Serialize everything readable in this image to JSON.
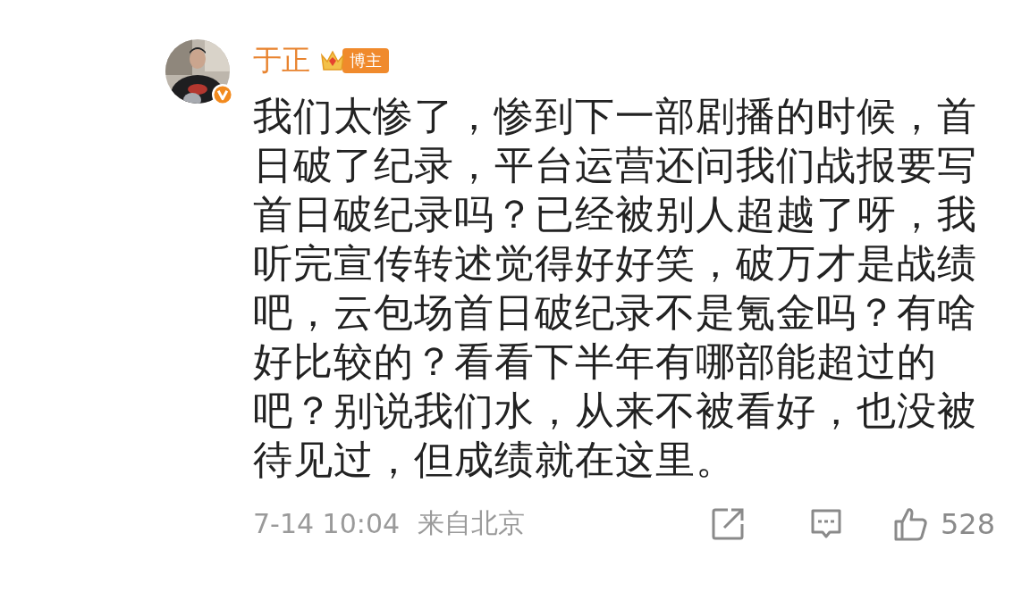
{
  "author": {
    "name": "于正",
    "badge": "博主"
  },
  "body": "我们太惨了，惨到下一部剧播的时候，首日破了纪录，平台运营还问我们战报要写首日破纪录吗？已经被别人超越了呀，我听完宣传转述觉得好好笑，破万才是战绩吧，云包场首日破纪录不是氪金吗？有啥好比较的？看看下半年有哪部能超过的吧？别说我们水，从来不被看好，也没被待见过，但成绩就在这里。",
  "footer": {
    "time": "7-14 10:04",
    "location": "来自北京",
    "likes": "528"
  }
}
